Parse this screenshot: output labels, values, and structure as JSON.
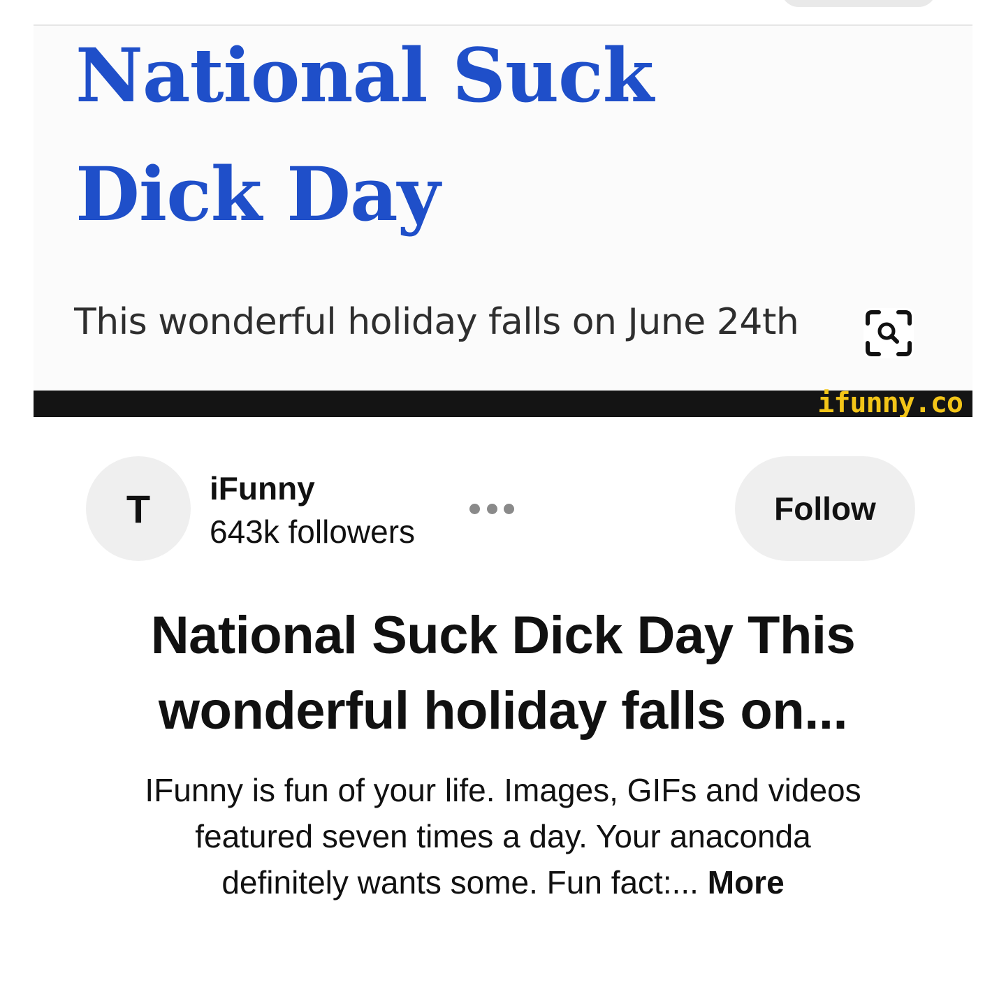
{
  "pin_image": {
    "headline_line1": "National Suck",
    "headline_line2": "Dick Day",
    "subtext": "This wonderful holiday falls on June 24th",
    "watermark": "ifunny.co",
    "headline_color": "#1f4fc9",
    "watermark_color": "#f3c518",
    "lens_icon": "visual-search-icon"
  },
  "creator": {
    "avatar_initial": "T",
    "name": "iFunny",
    "followers": "643k followers",
    "more_icon": "more-options-icon"
  },
  "actions": {
    "follow_label": "Follow"
  },
  "pin": {
    "title_line1": "National Suck Dick Day This",
    "title_line2": "wonderful holiday falls on...",
    "description_line1": "IFunny is fun of your life. Images, GIFs and videos",
    "description_line2": "featured seven times a day. Your anaconda",
    "description_line3": "definitely wants some. Fun fact:...",
    "more_label": "More"
  }
}
